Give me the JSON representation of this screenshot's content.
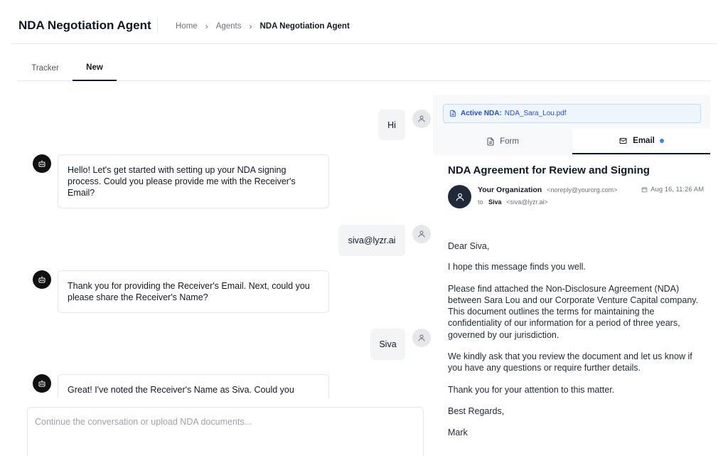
{
  "header": {
    "title": "NDA Negotiation Agent",
    "breadcrumb": [
      "Home",
      "Agents",
      "NDA Negotiation Agent"
    ],
    "breadcrumb_sep": "›"
  },
  "tabs": [
    {
      "label": "Tracker"
    },
    {
      "label": "New",
      "active": true
    }
  ],
  "chat": {
    "messages": [
      {
        "role": "user",
        "text": "Hi"
      },
      {
        "role": "bot",
        "text": "Hello! Let's get started with setting up your NDA signing process. Could you please provide me with the Receiver's Email?"
      },
      {
        "role": "user",
        "text": "siva@lyzr.ai"
      },
      {
        "role": "bot",
        "text": "Thank you for providing the Receiver's Email. Next, could you please share the Receiver's Name?"
      },
      {
        "role": "user",
        "text": "Siva"
      },
      {
        "role": "bot",
        "text": "Great! I've noted the Receiver's Name as Siva. Could you"
      }
    ],
    "composer_placeholder": "Continue the conversation or upload NDA documents..."
  },
  "panel": {
    "active_nda_label": "Active NDA:",
    "active_nda_file": "NDA_Sara_Lou.pdf",
    "tabs": [
      {
        "label": "Form",
        "icon": "document-icon"
      },
      {
        "label": "Email",
        "icon": "mail-icon",
        "active": true
      }
    ],
    "email": {
      "subject": "NDA Agreement for Review and Signing",
      "from_name": "Your Organization",
      "from_addr": "<noreply@yourorg.com>",
      "date": "Aug 16, 11:26 AM",
      "to_prefix": "to",
      "to_name": "Siva",
      "to_addr": "<siva@lyzr.ai>",
      "body": [
        "Dear Siva,",
        "I hope this message finds you well.",
        "Please find attached the Non-Disclosure Agreement (NDA) between Sara Lou and our Corporate Venture Capital company. This document outlines the terms for maintaining the confidentiality of our information for a period of three years, governed by our jurisdiction.",
        "We kindly ask that you review the document and let us know if you have any questions or require further details.",
        "Thank you for your attention to this matter.",
        "Best Regards,",
        "Mark"
      ]
    }
  },
  "colors": {
    "accent_blue": "#3b82f6",
    "active_nda_bg": "#eff6ff",
    "bot_avatar": "#111111"
  }
}
